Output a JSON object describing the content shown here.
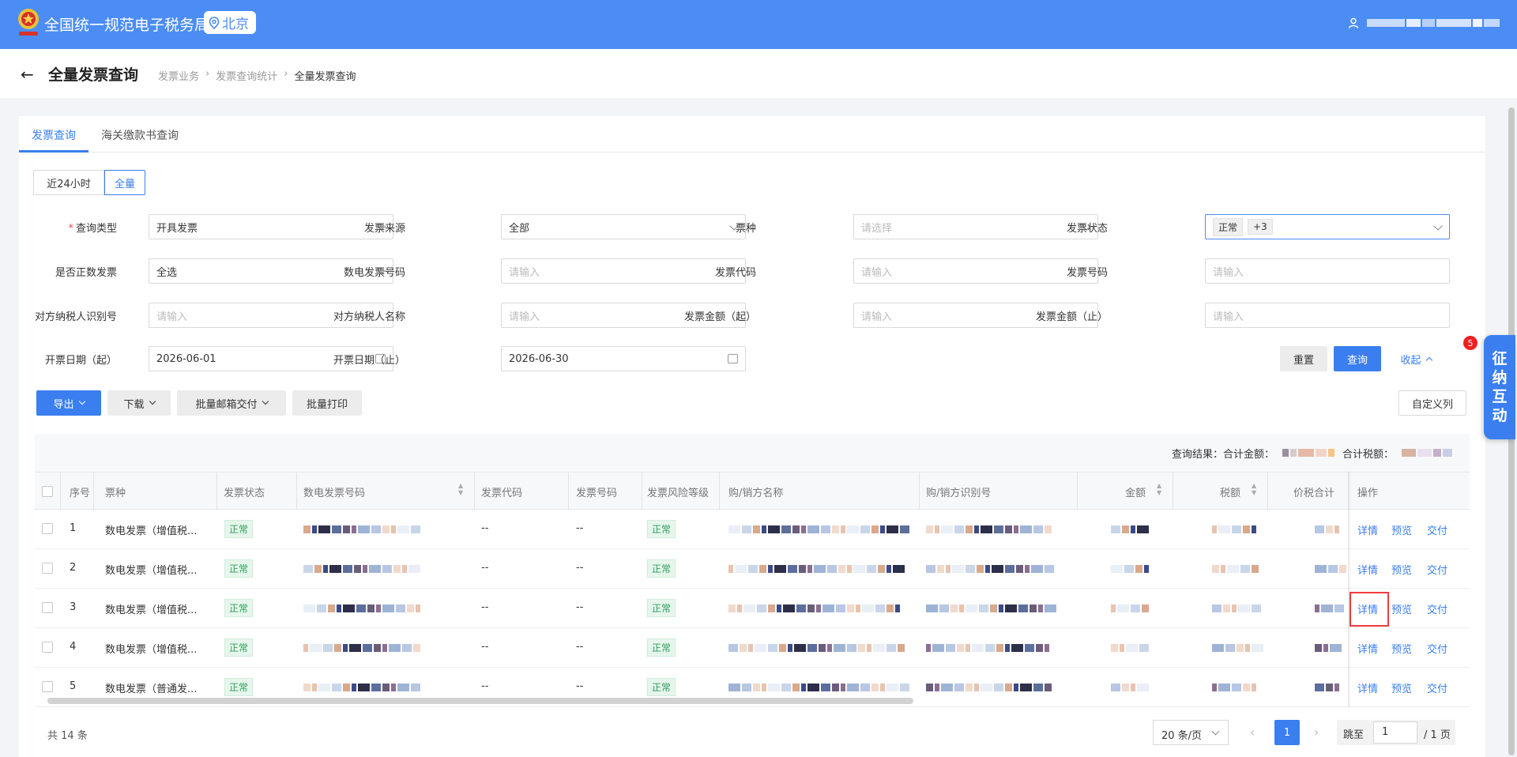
{
  "header": {
    "brand": "全国统一规范电子税务局",
    "location": "北京",
    "colors": {
      "topbar": "#4b8df5",
      "primary": "#3a7ef0",
      "status_green": "#2f9e5b"
    }
  },
  "page": {
    "title": "全量发票查询",
    "breadcrumbs": [
      "发票业务",
      "发票查询统计",
      "全量发票查询"
    ],
    "separator": "›"
  },
  "tabs": [
    "发票查询",
    "海关缴款书查询"
  ],
  "range": [
    "近24小时",
    "全量"
  ],
  "form": {
    "query_type": {
      "label": "查询类型",
      "value": "开具发票"
    },
    "source": {
      "label": "发票来源",
      "value": "全部"
    },
    "kind": {
      "label": "票种",
      "placeholder": "请选择"
    },
    "status": {
      "label": "发票状态",
      "tag1": "正常",
      "tag2": "+3"
    },
    "positive": {
      "label": "是否正数发票",
      "value": "全选"
    },
    "e_no": {
      "label": "数电发票号码",
      "placeholder": "请输入"
    },
    "code": {
      "label": "发票代码",
      "placeholder": "请输入"
    },
    "number": {
      "label": "发票号码",
      "placeholder": "请输入"
    },
    "party_id": {
      "label": "对方纳税人识别号",
      "placeholder": "请输入"
    },
    "party_name": {
      "label": "对方纳税人名称",
      "placeholder": "请输入"
    },
    "amt_from": {
      "label": "发票金额（起）",
      "placeholder": "请输入"
    },
    "amt_to": {
      "label": "发票金额（止）",
      "placeholder": "请输入"
    },
    "date_from": {
      "label": "开票日期（起）",
      "value": "2026-06-01"
    },
    "date_to": {
      "label": "开票日期（止）",
      "value": "2026-06-30"
    }
  },
  "actions": {
    "reset": "重置",
    "search": "查询",
    "collapse": "收起"
  },
  "toolbar": {
    "export": "导出",
    "download": "下载",
    "batch_email": "批量邮箱交付",
    "batch_print": "批量打印",
    "custom_cols": "自定义列"
  },
  "summary": {
    "label": "查询结果：合计金额：",
    "tax_label": "合计税额："
  },
  "columns": [
    "序号",
    "票种",
    "发票状态",
    "数电发票号码",
    "发票代码",
    "发票号码",
    "发票风险等级",
    "购/销方名称",
    "购/销方识别号",
    "金额",
    "税额",
    "价税合计",
    "操作"
  ],
  "row_actions": {
    "detail": "详情",
    "preview": "预览",
    "deliver": "交付"
  },
  "rows": [
    {
      "no": "1",
      "kind": "数电发票（增值税...",
      "status": "正常",
      "code": "--",
      "number": "--",
      "risk": "正常"
    },
    {
      "no": "2",
      "kind": "数电发票（增值税...",
      "status": "正常",
      "code": "--",
      "number": "--",
      "risk": "正常"
    },
    {
      "no": "3",
      "kind": "数电发票（增值税...",
      "status": "正常",
      "code": "--",
      "number": "--",
      "risk": "正常"
    },
    {
      "no": "4",
      "kind": "数电发票（增值税...",
      "status": "正常",
      "code": "--",
      "number": "--",
      "risk": "正常"
    },
    {
      "no": "5",
      "kind": "数电发票（普通发...",
      "status": "正常",
      "code": "--",
      "number": "--",
      "risk": "正常"
    }
  ],
  "pagination": {
    "total": "共 14 条",
    "page_size": "20 条/页",
    "current": "1",
    "jump_label": "跳至",
    "jump_value": "1",
    "pages": "/ 1 页",
    "prev": "‹",
    "next": "›"
  },
  "float_widget": {
    "chars": [
      "征",
      "纳",
      "互",
      "动"
    ],
    "badge": "5"
  }
}
